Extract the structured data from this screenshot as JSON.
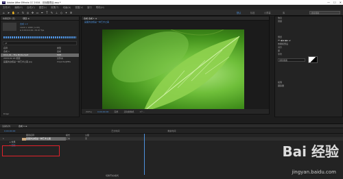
{
  "titlebar": {
    "logo": "Ae",
    "title": "Adobe After Effects CC 2018 - 无标题项目.aep *",
    "minimize": "—",
    "maximize": "☐",
    "close": "✕"
  },
  "menu": [
    "文件(F)",
    "编辑(E)",
    "合成(C)",
    "图层(L)",
    "效果(T)",
    "动画(A)",
    "视图(V)",
    "窗口",
    "帮助(H)"
  ],
  "workspace": {
    "tabs": [
      "默认",
      "标准",
      "小屏幕",
      "库"
    ],
    "search_placeholder": "搜索帮助"
  },
  "project": {
    "tab_effects": "效果控件 (无)",
    "tab_project": "项目 ≡",
    "composition_label": "合成 1 ▾",
    "info_line": "1920 x 1080 (1.00)",
    "duration_line": "Δ 0;00;10;00, 29.97 fps",
    "search_placeholder": "ρ▾",
    "columns": {
      "name": "名称",
      "type": "类型"
    },
    "items": [
      {
        "name": "合成 1",
        "type": "合成"
      },
      {
        "name": "0:11,41 - The Birds.mp3",
        "type": "MP3"
      },
      {
        "name": "2018-02-26 视频",
        "type": "文件夹"
      },
      {
        "name": "画面的边框是一种艺术之美.jpg",
        "type": "ImporterJPEG"
      }
    ],
    "footer": "8 bpc"
  },
  "composition": {
    "tab": "合成 合成 1 ≡",
    "breadcrumb": "画面的边框是一种艺术之美",
    "zoom": "(50%)",
    "time": "0;00;00;00",
    "quality": "完整",
    "camera": "活动摄像机",
    "views": "1个..."
  },
  "right_panel": {
    "info": "信息",
    "audio": "音频",
    "preview": "预览",
    "effects_presets": "效果和预设",
    "align": "对齐",
    "libraries": "库",
    "character": "字符",
    "font": "微软雅黑",
    "paragraph": "段落",
    "tracker": "跟踪器",
    "playback_controls": "⏮ ◀ ▶ ▶▶ ⏭"
  },
  "timeline": {
    "tab_render": "渲染队列",
    "tab_comp": "合成 1 ≡",
    "current_time": "0;00;00;00",
    "col_source": "图层名称",
    "col_mode": "模式",
    "col_parent": "父级",
    "ruler_center": "已分时间",
    "ruler_right": "剩余时间",
    "rows": [
      {
        "num": "1",
        "name": "画面的边框是一种艺术之美",
        "mode": "正常",
        "parent": "无"
      },
      {
        "num": "",
        "name": "效果",
        "mode": "",
        "parent": ""
      },
      {
        "num": "",
        "name": "蒙版",
        "mode": "",
        "parent": ""
      }
    ],
    "switch_label": "切换开关/模式"
  },
  "watermark": {
    "brand": "Bai 经验",
    "url": "jingyan.baidu.com"
  },
  "colors": {
    "accent": "#4e93e0",
    "highlight_box": "#e3222b"
  }
}
